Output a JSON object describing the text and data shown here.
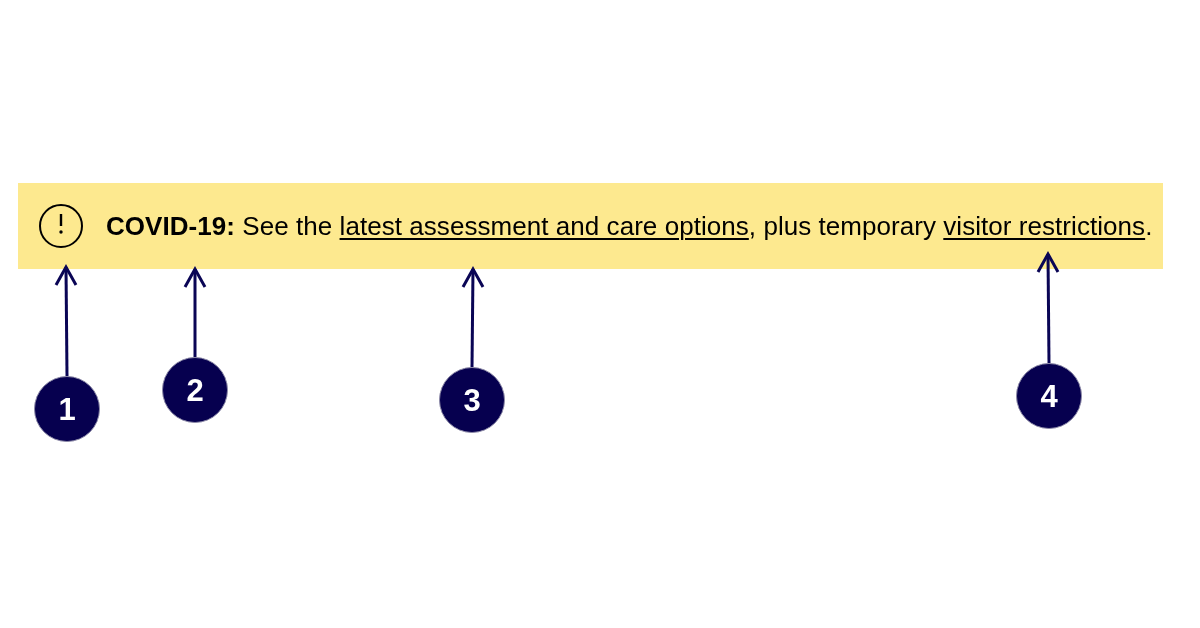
{
  "banner": {
    "message": [
      {
        "kind": "text",
        "text": "**COVID-19:** See the "
      },
      {
        "kind": "link",
        "text": "latest assessment and care options"
      },
      {
        "kind": "text",
        "text": ", plus temporary "
      },
      {
        "kind": "link",
        "text": "visitor restrictions"
      },
      {
        "kind": "text",
        "text": "."
      }
    ]
  },
  "callouts": [
    {
      "label": "1"
    },
    {
      "label": "2"
    },
    {
      "label": "3"
    },
    {
      "label": "4"
    }
  ]
}
